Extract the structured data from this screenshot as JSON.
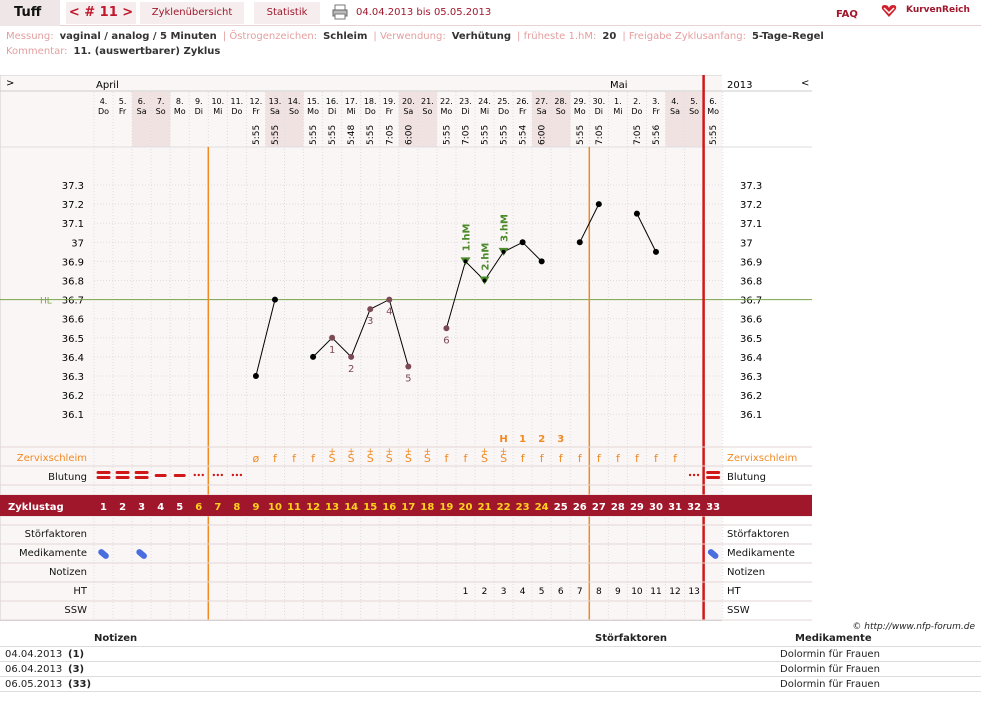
{
  "header": {
    "user": "Tuff",
    "cycle_nav": "< # 11 >",
    "tab_overview": "Zyklenübersicht",
    "tab_stats": "Statistik",
    "date_range": "04.04.2013 bis 05.05.2013",
    "faq": "FAQ",
    "logo_text": "KurvenReich"
  },
  "meta": {
    "messung_label": "Messung:",
    "messung_value": "vaginal / analog / 5 Minuten",
    "oestrogen_label": "Östrogenzeichen:",
    "oestrogen_value": "Schleim",
    "verwendung_label": "Verwendung:",
    "verwendung_value": "Verhütung",
    "frueheste_label": "früheste 1.hM:",
    "frueheste_value": "20",
    "freigabe_label": "Freigabe Zyklusanfang:",
    "freigabe_value": "5-Tage-Regel",
    "kommentar_label": "Kommentar:",
    "kommentar_value": "11. (auswertbarer) Zyklus"
  },
  "chart_nav": {
    "left": ">",
    "right": "<",
    "year": "2013",
    "month_april": "April",
    "month_mai": "Mai"
  },
  "days": [
    {
      "d": "4.",
      "w": "Do",
      "t": ""
    },
    {
      "d": "5.",
      "w": "Fr",
      "t": ""
    },
    {
      "d": "6.",
      "w": "Sa",
      "t": ""
    },
    {
      "d": "7.",
      "w": "So",
      "t": ""
    },
    {
      "d": "8.",
      "w": "Mo",
      "t": ""
    },
    {
      "d": "9.",
      "w": "Di",
      "t": ""
    },
    {
      "d": "10.",
      "w": "Mi",
      "t": ""
    },
    {
      "d": "11.",
      "w": "Do",
      "t": ""
    },
    {
      "d": "12.",
      "w": "Fr",
      "t": "5:55"
    },
    {
      "d": "13.",
      "w": "Sa",
      "t": "5:55"
    },
    {
      "d": "14.",
      "w": "So",
      "t": ""
    },
    {
      "d": "15.",
      "w": "Mo",
      "t": "5:55"
    },
    {
      "d": "16.",
      "w": "Di",
      "t": "5:55"
    },
    {
      "d": "17.",
      "w": "Mi",
      "t": "5:48"
    },
    {
      "d": "18.",
      "w": "Do",
      "t": "5:55"
    },
    {
      "d": "19.",
      "w": "Fr",
      "t": "7:05"
    },
    {
      "d": "20.",
      "w": "Sa",
      "t": "6:00"
    },
    {
      "d": "21.",
      "w": "So",
      "t": ""
    },
    {
      "d": "22.",
      "w": "Mo",
      "t": "5:55"
    },
    {
      "d": "23.",
      "w": "Di",
      "t": "7:05"
    },
    {
      "d": "24.",
      "w": "Mi",
      "t": "5:55"
    },
    {
      "d": "25.",
      "w": "Do",
      "t": "5:55"
    },
    {
      "d": "26.",
      "w": "Fr",
      "t": "5:54"
    },
    {
      "d": "27.",
      "w": "Sa",
      "t": "6:00"
    },
    {
      "d": "28.",
      "w": "So",
      "t": ""
    },
    {
      "d": "29.",
      "w": "Mo",
      "t": "5:55"
    },
    {
      "d": "30.",
      "w": "Di",
      "t": "7:05"
    },
    {
      "d": "1.",
      "w": "Mi",
      "t": ""
    },
    {
      "d": "2.",
      "w": "Do",
      "t": "7:05"
    },
    {
      "d": "3.",
      "w": "Fr",
      "t": "5:56"
    },
    {
      "d": "4.",
      "w": "Sa",
      "t": ""
    },
    {
      "d": "5.",
      "w": "So",
      "t": ""
    },
    {
      "d": "6.",
      "w": "Mo",
      "t": "5:55"
    }
  ],
  "chart_data": {
    "type": "line",
    "y_ticks": [
      "37.3",
      "37.2",
      "37.1",
      "37",
      "36.9",
      "36.8",
      "36.7",
      "36.6",
      "36.5",
      "36.4",
      "36.3",
      "36.2",
      "36.1"
    ],
    "ylim": [
      36.1,
      37.3
    ],
    "hl_label": "HL",
    "hl_value": 36.7,
    "segments": [
      [
        [
          9,
          36.3
        ],
        [
          10,
          36.7
        ]
      ],
      [
        [
          12,
          36.4
        ],
        [
          13,
          36.5
        ],
        [
          14,
          36.4
        ],
        [
          15,
          36.65
        ],
        [
          16,
          36.7
        ],
        [
          17,
          36.35
        ]
      ],
      [
        [
          19,
          36.55
        ],
        [
          20,
          36.9
        ],
        [
          21,
          36.8
        ],
        [
          22,
          36.95
        ],
        [
          23,
          37.0
        ],
        [
          24,
          36.9
        ]
      ],
      [
        [
          26,
          37.0
        ],
        [
          27,
          37.2
        ]
      ],
      [
        [
          29,
          37.15
        ],
        [
          30,
          36.95
        ]
      ]
    ],
    "excluded_days": [
      13,
      14,
      15,
      16,
      17,
      19
    ],
    "excluded_labels": [
      {
        "day": 13,
        "n": "1"
      },
      {
        "day": 14,
        "n": "2"
      },
      {
        "day": 15,
        "n": "3"
      },
      {
        "day": 16,
        "n": "4"
      },
      {
        "day": 17,
        "n": "5"
      },
      {
        "day": 19,
        "n": "6"
      }
    ],
    "hm_markers": [
      {
        "day": 20,
        "label": "1.hM"
      },
      {
        "day": 21,
        "label": "2.hM"
      },
      {
        "day": 22,
        "label": "3.hM"
      }
    ]
  },
  "peak_row": [
    {
      "day": 22,
      "v": "H"
    },
    {
      "day": 23,
      "v": "1"
    },
    {
      "day": 24,
      "v": "2"
    },
    {
      "day": 25,
      "v": "3"
    }
  ],
  "rows": {
    "zervix_label": "Zervixschleim",
    "blutung_label": "Blutung",
    "zyklustag_label": "Zyklustag",
    "stoer_label": "Störfaktoren",
    "medi_label": "Medikamente",
    "notizen_label": "Notizen",
    "ht_label": "HT",
    "ssw_label": "SSW"
  },
  "zervix": [
    "",
    "",
    "",
    "",
    "",
    "",
    "",
    "",
    "ø",
    "f",
    "f",
    "f",
    "S",
    "S",
    "S",
    "S",
    "S",
    "S",
    "f",
    "f",
    "S",
    "S",
    "f",
    "f",
    "f",
    "f",
    "f",
    "f",
    "f",
    "f",
    "f",
    "",
    ""
  ],
  "zervix_plus": [
    13,
    14,
    15,
    16,
    17,
    18,
    21,
    22
  ],
  "bleeding": [
    "big",
    "big",
    "big",
    "med",
    "med",
    "dot",
    "dot",
    "dot",
    "",
    "",
    "",
    "",
    "",
    "",
    "",
    "",
    "",
    "",
    "",
    "",
    "",
    "",
    "",
    "",
    "",
    "",
    "",
    "",
    "",
    "",
    "",
    "dot",
    "big"
  ],
  "zyklustag": [
    "1",
    "2",
    "3",
    "4",
    "5",
    "6",
    "7",
    "8",
    "9",
    "10",
    "11",
    "12",
    "13",
    "14",
    "15",
    "16",
    "17",
    "18",
    "19",
    "20",
    "21",
    "22",
    "23",
    "24",
    "25",
    "26",
    "27",
    "28",
    "29",
    "30",
    "31",
    "32",
    "33"
  ],
  "ht": [
    "",
    "",
    "",
    "",
    "",
    "",
    "",
    "",
    "",
    "",
    "",
    "",
    "",
    "",
    "",
    "",
    "",
    "",
    "",
    "1",
    "2",
    "3",
    "4",
    "5",
    "6",
    "7",
    "8",
    "9",
    "10",
    "11",
    "12",
    "13",
    ""
  ],
  "copyright": "© http://www.nfp-forum.de",
  "footer": {
    "col_notizen": "Notizen",
    "col_stoer": "Störfaktoren",
    "col_medi": "Medikamente",
    "rows": [
      {
        "date": "04.04.2013",
        "num": "(1)",
        "medi": "Dolormin für Frauen"
      },
      {
        "date": "06.04.2013",
        "num": "(3)",
        "medi": "Dolormin für Frauen"
      },
      {
        "date": "06.05.2013",
        "num": "(33)",
        "medi": "Dolormin für Frauen"
      }
    ]
  }
}
